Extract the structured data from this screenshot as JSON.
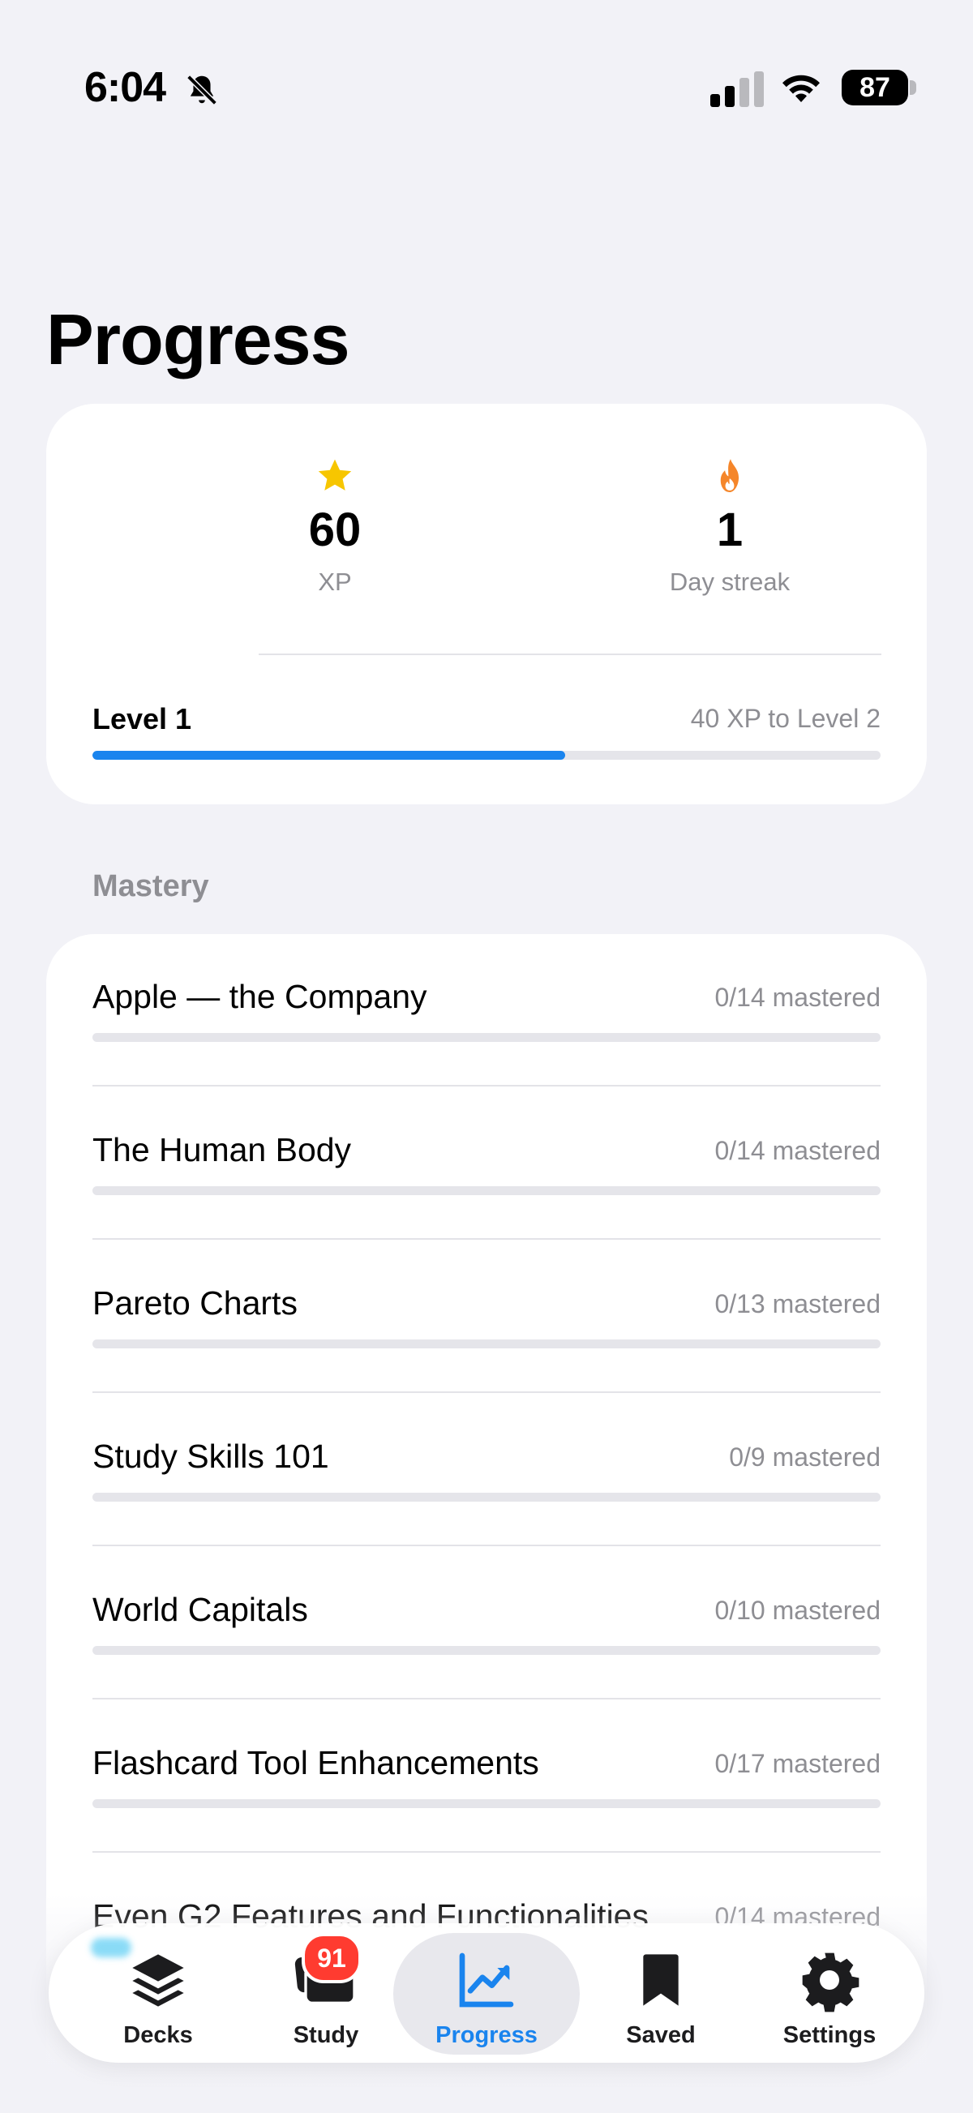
{
  "status_bar": {
    "time": "6:04",
    "battery": "87"
  },
  "page": {
    "title": "Progress"
  },
  "stats": {
    "xp_value": "60",
    "xp_label": "XP",
    "streak_value": "1",
    "streak_label": "Day streak",
    "level_label": "Level 1",
    "level_next": "40 XP to Level 2",
    "level_progress": 0.6
  },
  "mastery": {
    "section_label": "Mastery",
    "decks": [
      {
        "name": "Apple — the Company",
        "count": "0/14 mastered",
        "progress": 0
      },
      {
        "name": "The Human Body",
        "count": "0/14 mastered",
        "progress": 0
      },
      {
        "name": "Pareto Charts",
        "count": "0/13 mastered",
        "progress": 0
      },
      {
        "name": "Study Skills 101",
        "count": "0/9 mastered",
        "progress": 0
      },
      {
        "name": "World Capitals",
        "count": "0/10 mastered",
        "progress": 0
      },
      {
        "name": "Flashcard Tool Enhancements",
        "count": "0/17 mastered",
        "progress": 0
      },
      {
        "name": "Even G2 Features and Functionalities",
        "count": "0/14 mastered",
        "progress": 0
      }
    ]
  },
  "tab_bar": {
    "tabs": [
      {
        "label": "Decks",
        "icon": "layers-icon"
      },
      {
        "label": "Study",
        "icon": "cards-icon"
      },
      {
        "label": "Progress",
        "icon": "chart-icon"
      },
      {
        "label": "Saved",
        "icon": "bookmark-icon"
      },
      {
        "label": "Settings",
        "icon": "gear-icon"
      }
    ],
    "study_badge": "91",
    "selected": "Progress"
  },
  "colors": {
    "accent": "#1a84ee",
    "background": "#f2f2f7",
    "badge": "#ff3b30",
    "star": "#f7c600",
    "flame": "#f5862a"
  }
}
